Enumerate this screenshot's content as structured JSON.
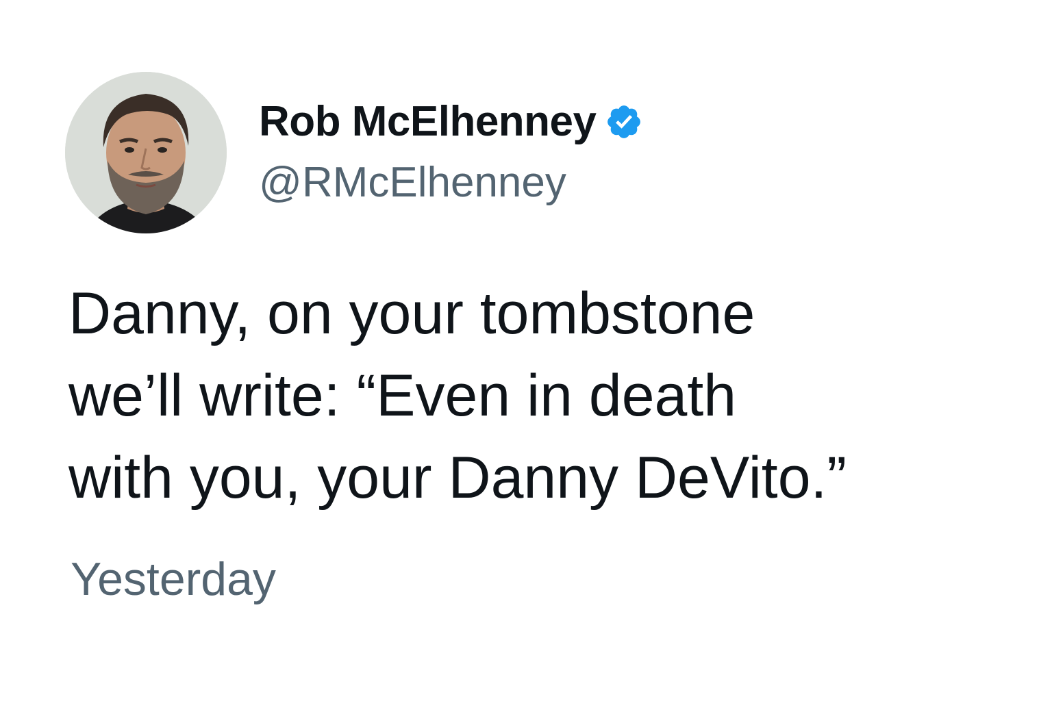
{
  "author": {
    "display_name": "Rob McElhenney",
    "handle": "@RMcElhenney",
    "verified": true,
    "verified_color": "#1d9bf0",
    "avatar_icon": "profile-photo"
  },
  "tweet": {
    "lines": [
      "Danny, on your tombstone",
      "we’ll write: “Even in death",
      "with you, your Danny DeVito.”"
    ]
  },
  "timestamp": "Yesterday",
  "colors": {
    "text_primary": "#0f1419",
    "text_secondary": "#536471",
    "background": "#ffffff"
  }
}
